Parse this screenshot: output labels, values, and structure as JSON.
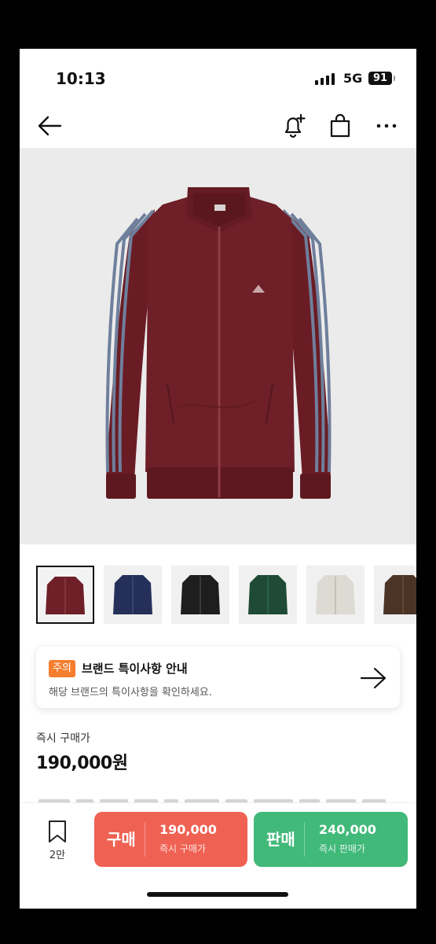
{
  "status": {
    "time": "10:13",
    "network": "5G",
    "battery": "91"
  },
  "notice": {
    "badge": "주의",
    "title": "브랜드 특이사항 안내",
    "subtitle": "해당 브랜드의 특이사항을 확인하세요."
  },
  "price": {
    "label": "즉시 구매가",
    "value": "190,000원"
  },
  "thumbnails": [
    {
      "color": "#6e1f27",
      "selected": true
    },
    {
      "color": "#25305a",
      "selected": false
    },
    {
      "color": "#1e1e1e",
      "selected": false
    },
    {
      "color": "#1f4a35",
      "selected": false
    },
    {
      "color": "#dcdad2",
      "selected": false
    },
    {
      "color": "#4b3426",
      "selected": false
    }
  ],
  "wishlist": {
    "count": "2만"
  },
  "buy": {
    "label": "구매",
    "price": "190,000",
    "sub": "즉시 구매가",
    "color": "#ef6253"
  },
  "sell": {
    "label": "판매",
    "price": "240,000",
    "sub": "즉시 판매가",
    "color": "#41b979"
  },
  "colors": {
    "badge": "#f57e2f",
    "jacket": "#6e1f27",
    "stripe": "#6f7f9c"
  }
}
